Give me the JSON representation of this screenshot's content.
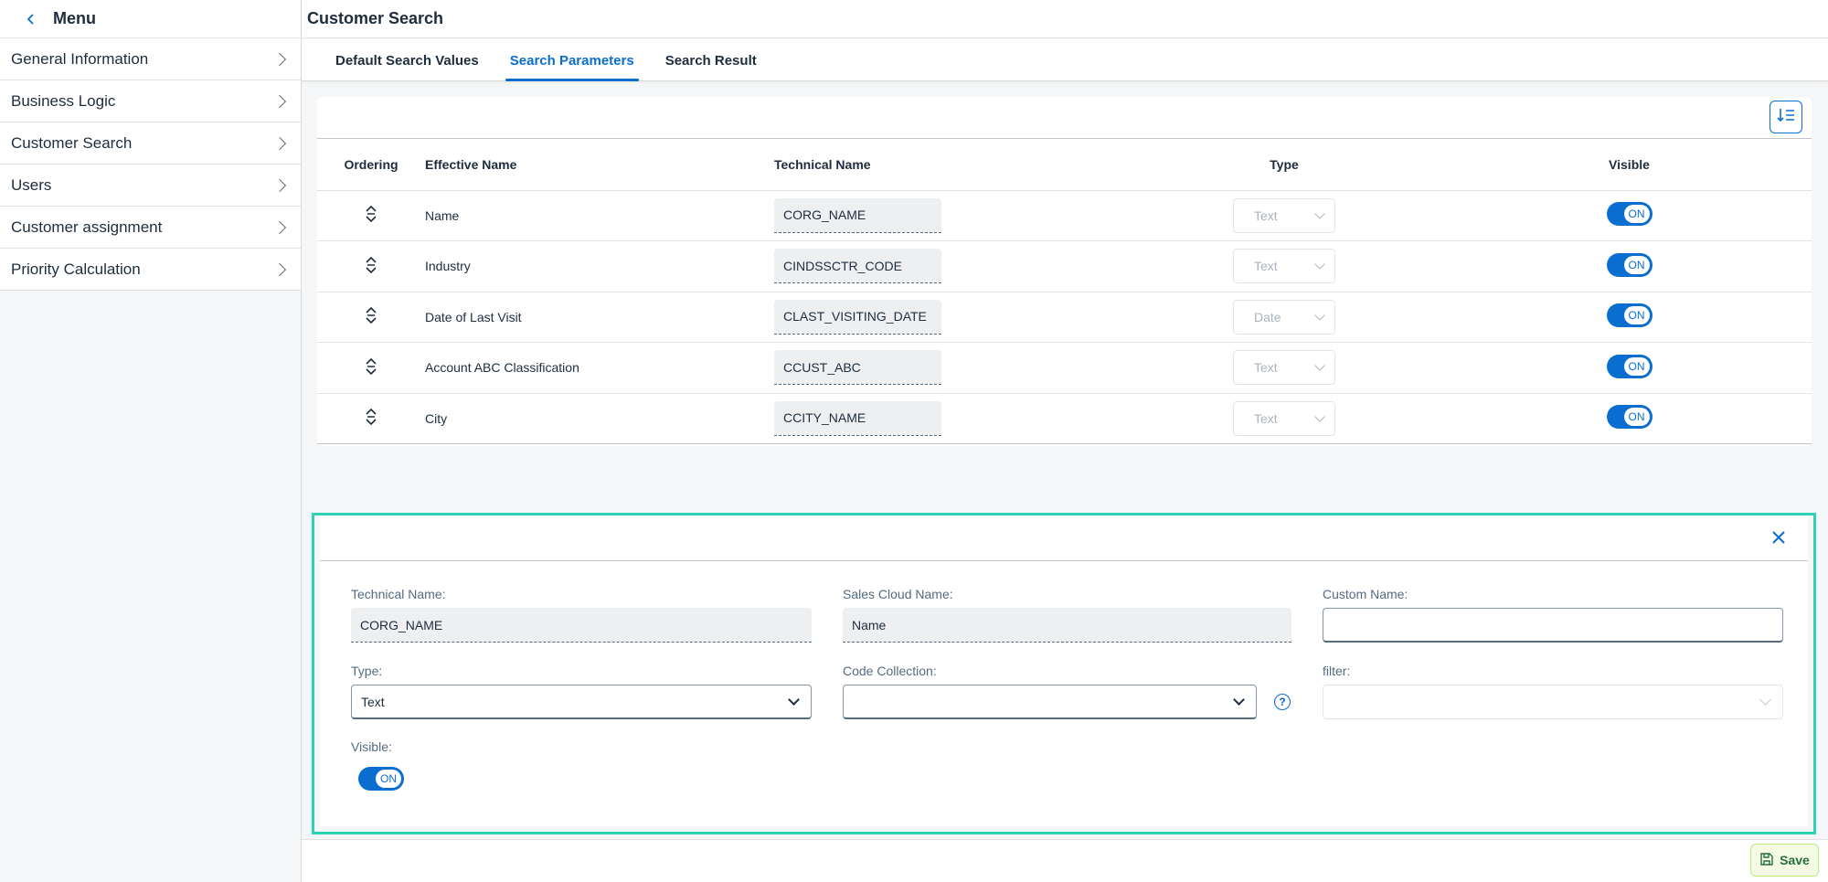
{
  "sidebar": {
    "title": "Menu",
    "items": [
      {
        "label": "General Information"
      },
      {
        "label": "Business Logic"
      },
      {
        "label": "Customer Search"
      },
      {
        "label": "Users"
      },
      {
        "label": "Customer assignment"
      },
      {
        "label": "Priority Calculation"
      }
    ]
  },
  "header": {
    "title": "Customer Search"
  },
  "tabs": [
    {
      "label": "Default Search Values",
      "active": false
    },
    {
      "label": "Search Parameters",
      "active": true
    },
    {
      "label": "Search Result",
      "active": false
    }
  ],
  "table": {
    "columns": {
      "ordering": "Ordering",
      "effective_name": "Effective Name",
      "technical_name": "Technical Name",
      "type": "Type",
      "visible": "Visible"
    },
    "rows": [
      {
        "effective_name": "Name",
        "technical_name": "CORG_NAME",
        "type": "Text",
        "visible": "ON"
      },
      {
        "effective_name": "Industry",
        "technical_name": "CINDSSCTR_CODE",
        "type": "Text",
        "visible": "ON"
      },
      {
        "effective_name": "Date of Last Visit",
        "technical_name": "CLAST_VISITING_DATE",
        "type": "Date",
        "visible": "ON"
      },
      {
        "effective_name": "Account ABC Classification",
        "technical_name": "CCUST_ABC",
        "type": "Text",
        "visible": "ON"
      },
      {
        "effective_name": "City",
        "technical_name": "CCITY_NAME",
        "type": "Text",
        "visible": "ON"
      }
    ]
  },
  "detail": {
    "technical_name_label": "Technical Name:",
    "technical_name_value": "CORG_NAME",
    "sales_cloud_name_label": "Sales Cloud Name:",
    "sales_cloud_name_value": "Name",
    "custom_name_label": "Custom Name:",
    "custom_name_value": "",
    "type_label": "Type:",
    "type_value": "Text",
    "code_collection_label": "Code Collection:",
    "code_collection_value": "",
    "help_glyph": "?",
    "filter_label": "filter:",
    "filter_value": "",
    "visible_label": "Visible:",
    "visible_value": "ON"
  },
  "footer": {
    "save_label": "Save"
  },
  "colors": {
    "accent": "#0a6ed1",
    "highlight_border": "#2ed3b4",
    "save_text": "#256f3a"
  }
}
